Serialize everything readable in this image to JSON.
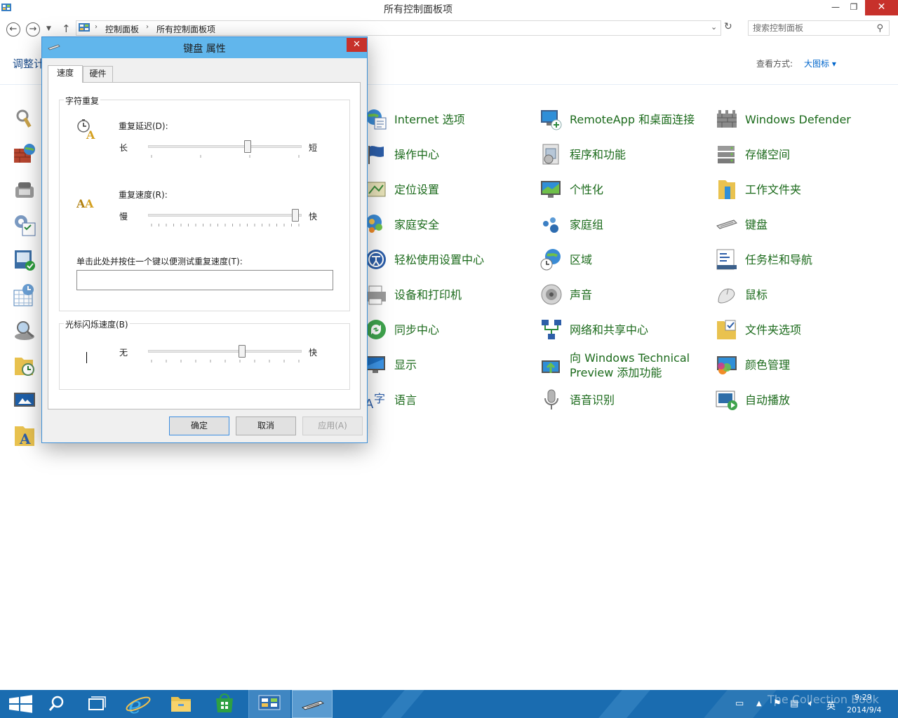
{
  "window": {
    "title": "所有控制面板项",
    "minimize": "—",
    "maximize": "❐",
    "close": "✕"
  },
  "nav": {
    "back": "←",
    "forward": "→",
    "recent": "▼",
    "up": "↑",
    "breadcrumb": [
      "控制面板",
      "所有控制面板项"
    ],
    "separator": "›",
    "dropdown": "⌄",
    "refresh": "↻",
    "search_placeholder": "搜索控制面板",
    "search_icon": "⚲"
  },
  "header": {
    "heading": "调整计算机的设置",
    "view_label": "查看方式:",
    "view_value": "大图标 ▾"
  },
  "items": [
    {
      "label": "Internet 选项",
      "icon": "internet-options-icon"
    },
    {
      "label": "RemoteApp 和桌面连接",
      "icon": "remoteapp-icon"
    },
    {
      "label": "Windows Defender",
      "icon": "windows-defender-icon"
    },
    {
      "label": "操作中心",
      "icon": "action-center-flag-icon"
    },
    {
      "label": "程序和功能",
      "icon": "programs-features-icon"
    },
    {
      "label": "存储空间",
      "icon": "storage-spaces-icon"
    },
    {
      "label": "定位设置",
      "icon": "location-settings-icon"
    },
    {
      "label": "个性化",
      "icon": "personalization-icon"
    },
    {
      "label": "工作文件夹",
      "icon": "work-folders-icon"
    },
    {
      "label": "家庭安全",
      "icon": "family-safety-icon"
    },
    {
      "label": "家庭组",
      "icon": "homegroup-icon"
    },
    {
      "label": "键盘",
      "icon": "keyboard-icon"
    },
    {
      "label": "轻松使用设置中心",
      "icon": "ease-of-access-icon"
    },
    {
      "label": "区域",
      "icon": "region-icon"
    },
    {
      "label": "任务栏和导航",
      "icon": "taskbar-navigation-icon"
    },
    {
      "label": "设备和打印机",
      "icon": "devices-printers-icon"
    },
    {
      "label": "声音",
      "icon": "sound-icon"
    },
    {
      "label": "鼠标",
      "icon": "mouse-icon"
    },
    {
      "label": "同步中心",
      "icon": "sync-center-icon"
    },
    {
      "label": "网络和共享中心",
      "icon": "network-sharing-icon"
    },
    {
      "label": "文件夹选项",
      "icon": "folder-options-icon"
    },
    {
      "label": "显示",
      "icon": "display-icon"
    },
    {
      "label": "向 Windows Technical Preview 添加功能",
      "label_line1": "向 Windows Technical",
      "label_line2": "Preview 添加功能",
      "icon": "add-features-icon"
    },
    {
      "label": "颜色管理",
      "icon": "color-management-icon"
    },
    {
      "label": "语言",
      "icon": "language-icon"
    },
    {
      "label": "语音识别",
      "icon": "speech-recognition-icon"
    },
    {
      "label": "自动播放",
      "icon": "autoplay-icon"
    }
  ],
  "dialog": {
    "title": "键盘 属性",
    "close": "✕",
    "tabs": [
      "速度",
      "硬件"
    ],
    "char_repeat": {
      "group_label": "字符重复",
      "delay_label": "重复延迟(D):",
      "delay_min": "长",
      "delay_max": "短",
      "delay_value": 0.66,
      "rate_label": "重复速度(R):",
      "rate_min": "慢",
      "rate_max": "快",
      "rate_value": 1.0,
      "test_label": "单击此处并按住一个键以便测试重复速度(T):",
      "test_value": ""
    },
    "cursor_blink": {
      "group_label": "光标闪烁速度(B)",
      "min": "无",
      "max": "快",
      "value": 0.62
    },
    "buttons": {
      "ok": "确定",
      "cancel": "取消",
      "apply": "应用(A)"
    }
  },
  "taskbar": {
    "clock_time": "9:29",
    "clock_date": "2014/9/4",
    "ime": "英",
    "watermark": "The Collection Book"
  }
}
